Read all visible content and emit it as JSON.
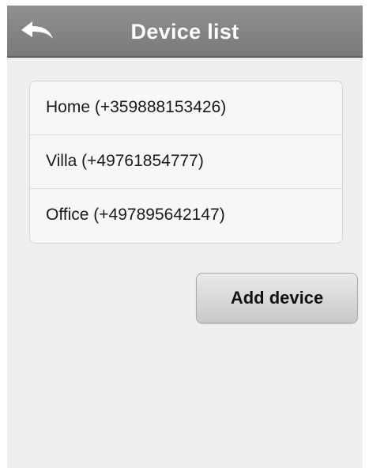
{
  "header": {
    "title": "Device list",
    "back_icon": "back-arrow-icon"
  },
  "devices": [
    {
      "label": "Home (+359888153426)"
    },
    {
      "label": "Villa (+49761854777)"
    },
    {
      "label": "Office (+497895642147)"
    }
  ],
  "actions": {
    "add_device_label": "Add device"
  },
  "colors": {
    "header_bg": "#858585",
    "screen_bg": "#efefef",
    "list_bg": "#f7f7f7",
    "title_text": "#ffffff"
  }
}
